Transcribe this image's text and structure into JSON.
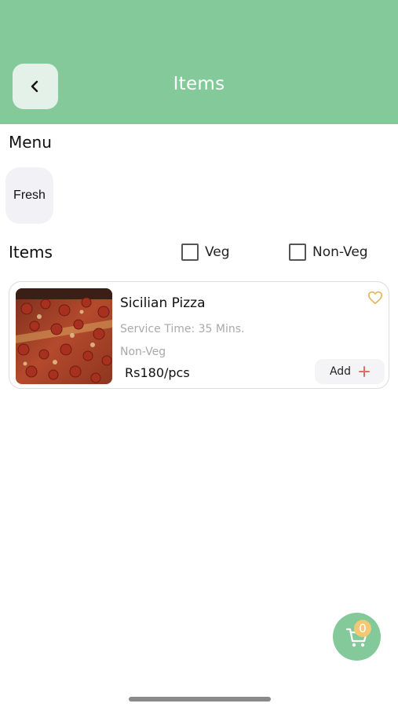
{
  "header": {
    "title": "Items",
    "back_icon": "chevron-left-icon"
  },
  "menu": {
    "label": "Menu",
    "chips": [
      {
        "label": "Fresh"
      }
    ]
  },
  "items_section": {
    "label": "Items",
    "filters": [
      {
        "label": "Veg",
        "checked": false
      },
      {
        "label": "Non-Veg",
        "checked": false
      }
    ]
  },
  "items": [
    {
      "name": "Sicilian Pizza",
      "service_time": "Service Time: 35 Mins.",
      "type": "Non-Veg",
      "price": "Rs180/pcs",
      "add_label": "Add",
      "favorite": false,
      "image_icon": "pizza-image"
    }
  ],
  "cart": {
    "count": "0",
    "icon": "cart-icon"
  },
  "colors": {
    "primary": "#83c99a",
    "badge": "#f3c872",
    "add_plus": "#e36a6a",
    "heart": "#e5b35c"
  }
}
